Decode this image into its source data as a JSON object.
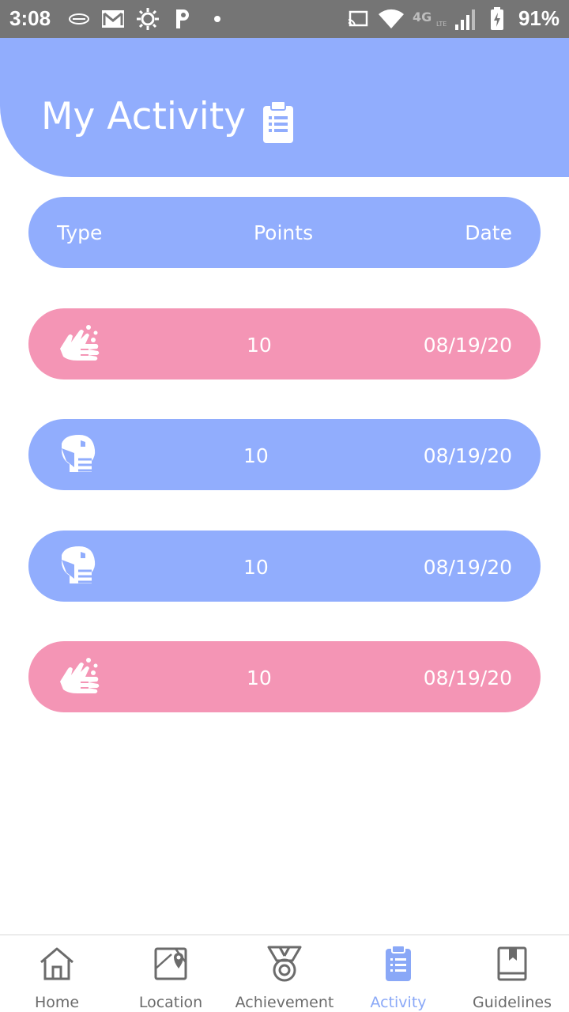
{
  "status_bar": {
    "time": "3:08",
    "battery": "91%",
    "network": "4G"
  },
  "header": {
    "title": "My Activity",
    "icon": "clipboard-icon",
    "color": "#91adfd"
  },
  "table": {
    "columns": [
      "Type",
      "Points",
      "Date"
    ],
    "rows": [
      {
        "type_icon": "hand-wash-icon",
        "points": "10",
        "date": "08/19/20",
        "color": "#f495b5"
      },
      {
        "type_icon": "face-mask-icon",
        "points": "10",
        "date": "08/19/20",
        "color": "#91adfd"
      },
      {
        "type_icon": "face-mask-icon",
        "points": "10",
        "date": "08/19/20",
        "color": "#91adfd"
      },
      {
        "type_icon": "hand-wash-icon",
        "points": "10",
        "date": "08/19/20",
        "color": "#f495b5"
      }
    ]
  },
  "bottom_nav": {
    "items": [
      {
        "label": "Home",
        "icon": "home-icon"
      },
      {
        "label": "Location",
        "icon": "map-icon"
      },
      {
        "label": "Achievement",
        "icon": "medal-icon"
      },
      {
        "label": "Activity",
        "icon": "clipboard-icon",
        "active": true
      },
      {
        "label": "Guidelines",
        "icon": "book-icon"
      }
    ],
    "active_color": "#8aa8f7",
    "inactive_color": "#6b6b6b"
  }
}
